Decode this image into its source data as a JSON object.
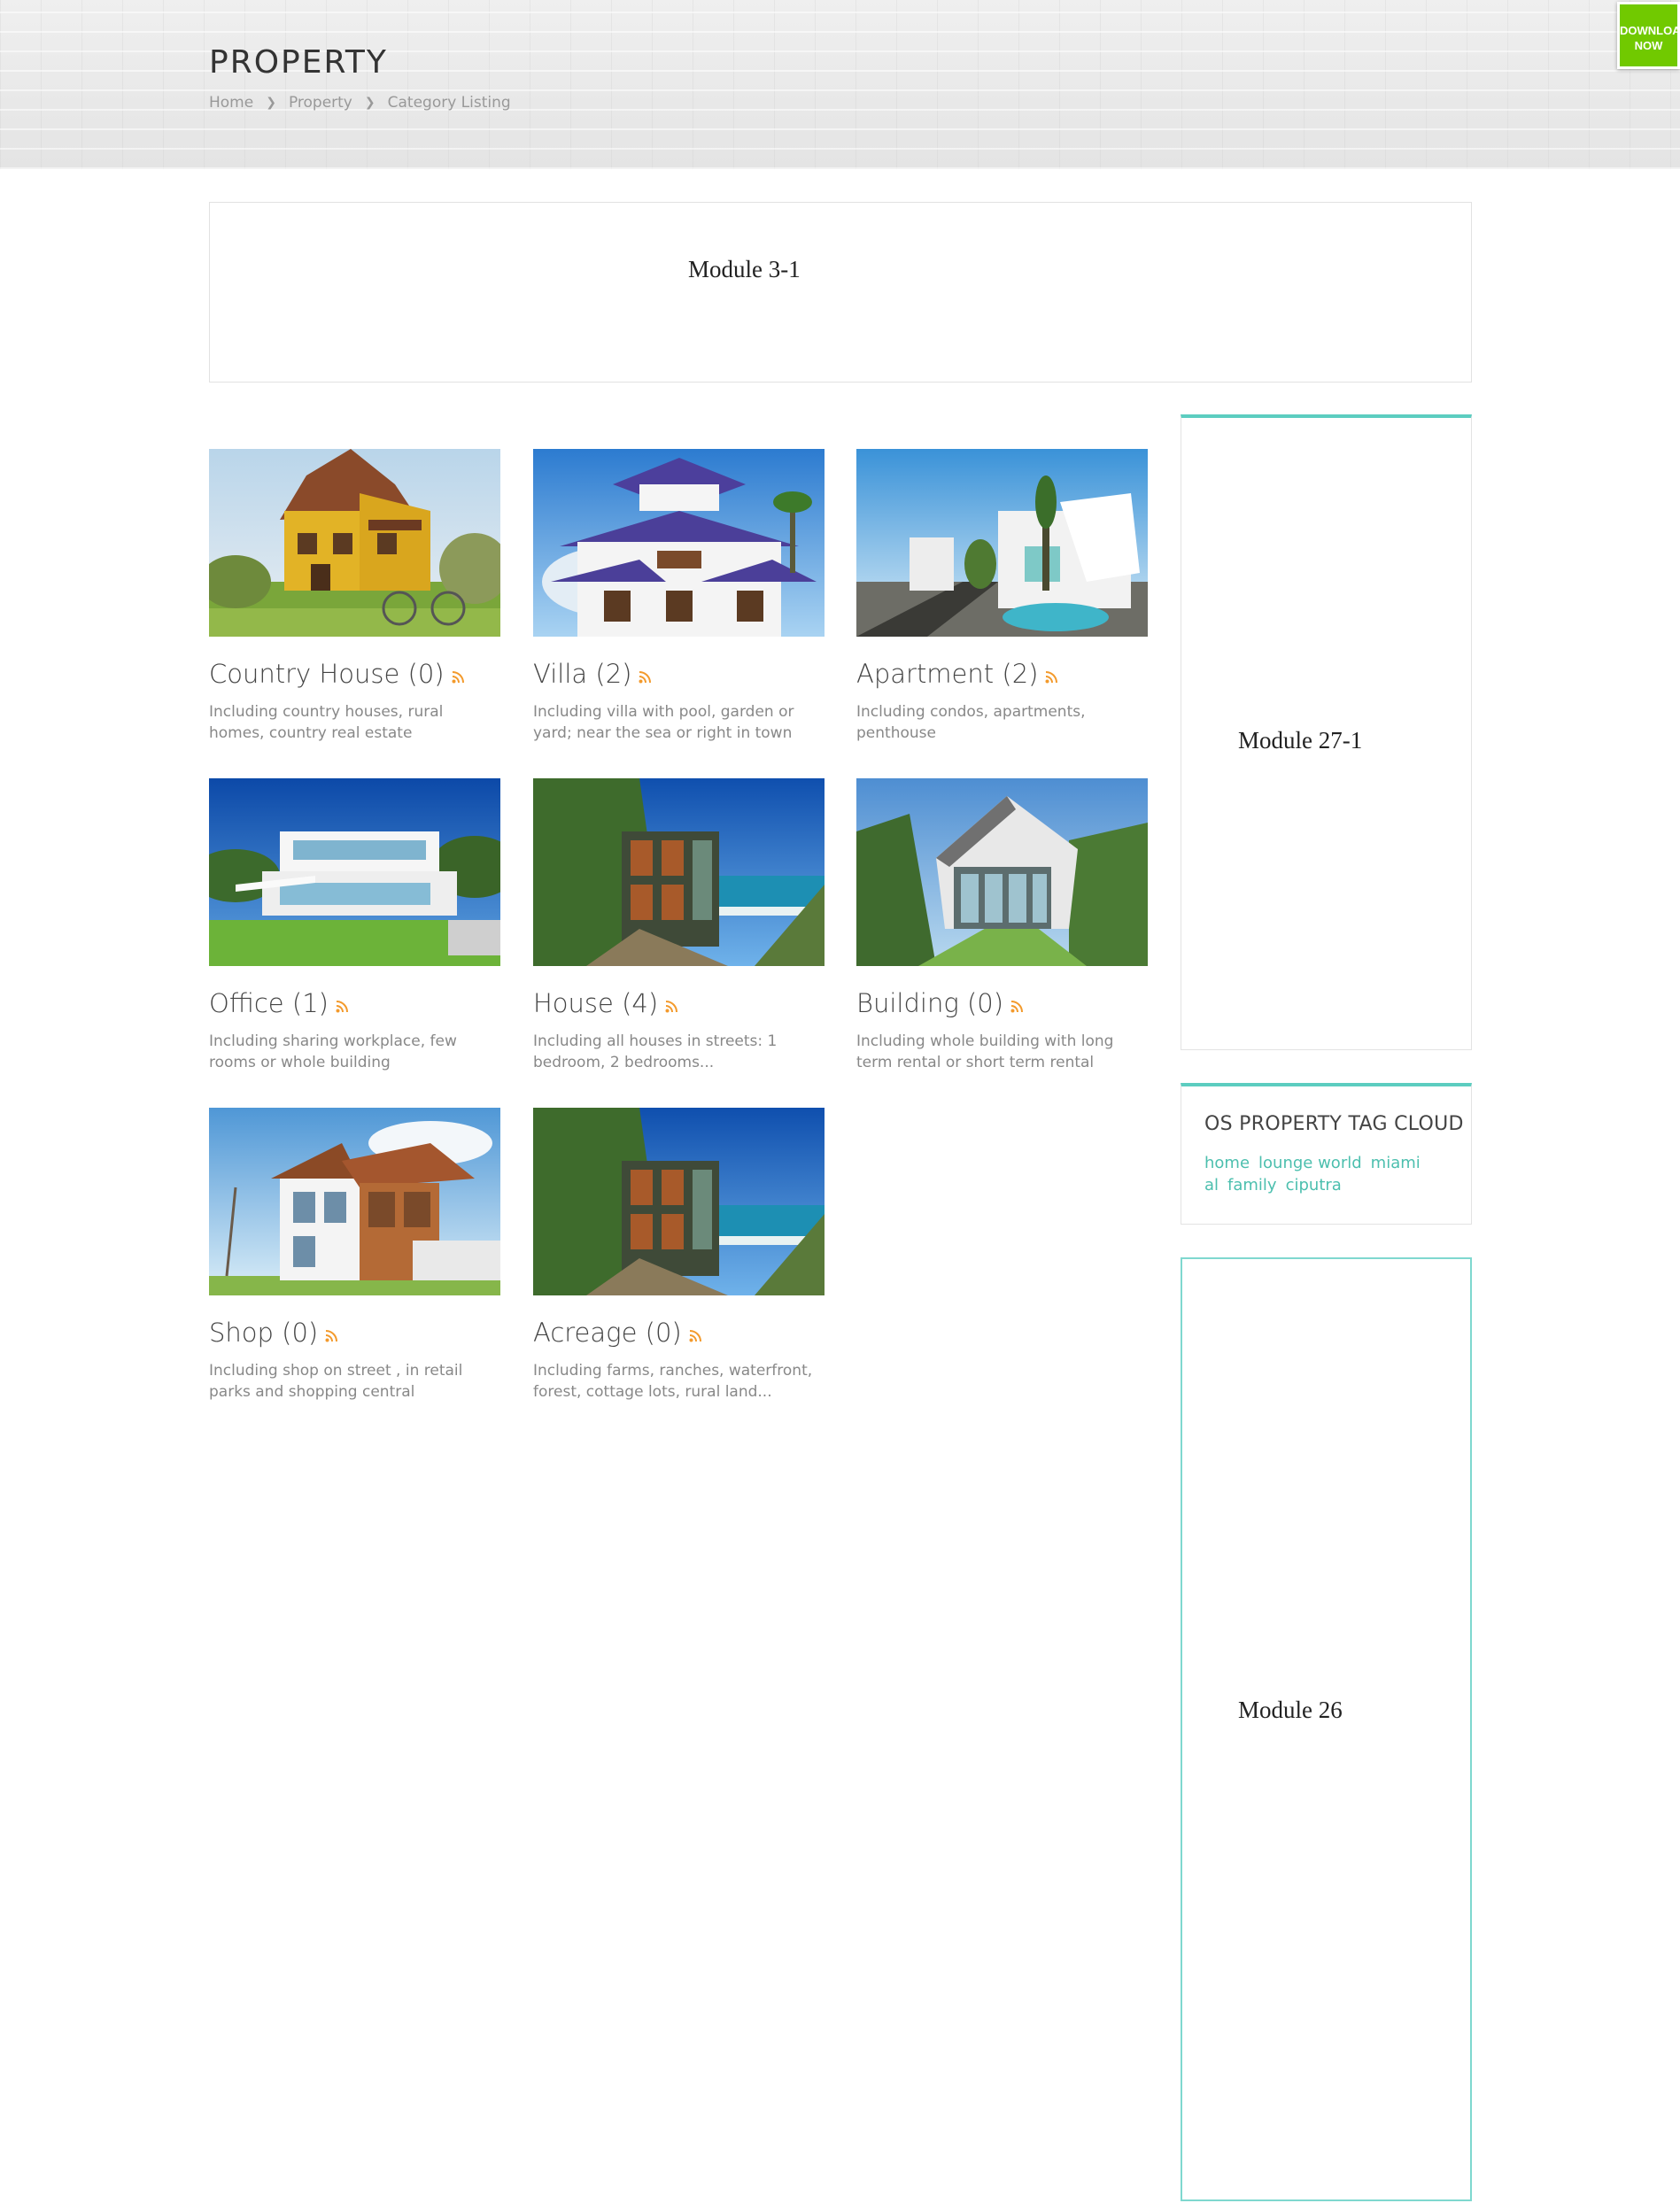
{
  "header": {
    "title": "PROPERTY",
    "breadcrumb": [
      "Home",
      "Property",
      "Category Listing"
    ]
  },
  "download_button": {
    "line1": "DOWNLOA",
    "line2": "NOW"
  },
  "modules": {
    "top": "Module 3-1",
    "sidebar_top": "Module 27-1",
    "sidebar_bottom": "Module 26"
  },
  "categories": [
    {
      "name": "Country House",
      "count": "(0)",
      "description": "Including country houses, rural homes, country real estate",
      "image": "yellow-country-house"
    },
    {
      "name": "Villa",
      "count": "(2)",
      "description": "Including villa with pool, garden or yard; near the sea or right in town",
      "image": "white-villa-purple-roof"
    },
    {
      "name": "Apartment",
      "count": "(2)",
      "description": "Including condos, apartments, penthouse",
      "image": "modern-house-pool"
    },
    {
      "name": "Office",
      "count": "(1)",
      "description": "Including sharing workplace, few rooms or whole building",
      "image": "modern-white-office"
    },
    {
      "name": "House",
      "count": "(4)",
      "description": "Including all houses in streets: 1 bedroom, 2 bedrooms...",
      "image": "cliff-house-sea"
    },
    {
      "name": "Building",
      "count": "(0)",
      "description": "Including whole building with long term rental or short term rental",
      "image": "glass-hillside-building"
    },
    {
      "name": "Shop",
      "count": "(0)",
      "description": "Including shop on street , in retail parks and shopping central",
      "image": "white-wood-shop"
    },
    {
      "name": "Acreage",
      "count": "(0)",
      "description": "Including farms, ranches, waterfront, forest, cottage lots, rural land...",
      "image": "cliff-house-sea"
    }
  ],
  "tag_cloud": {
    "title": "OS PROPERTY TAG CLOUD",
    "tags": [
      "home",
      "lounge world",
      "miami",
      "al",
      "family",
      "ciputra"
    ]
  },
  "colors": {
    "accent": "#5ccdc0",
    "tag": "#4cbfae",
    "rss": "#f39a2c",
    "download": "#71c900"
  }
}
